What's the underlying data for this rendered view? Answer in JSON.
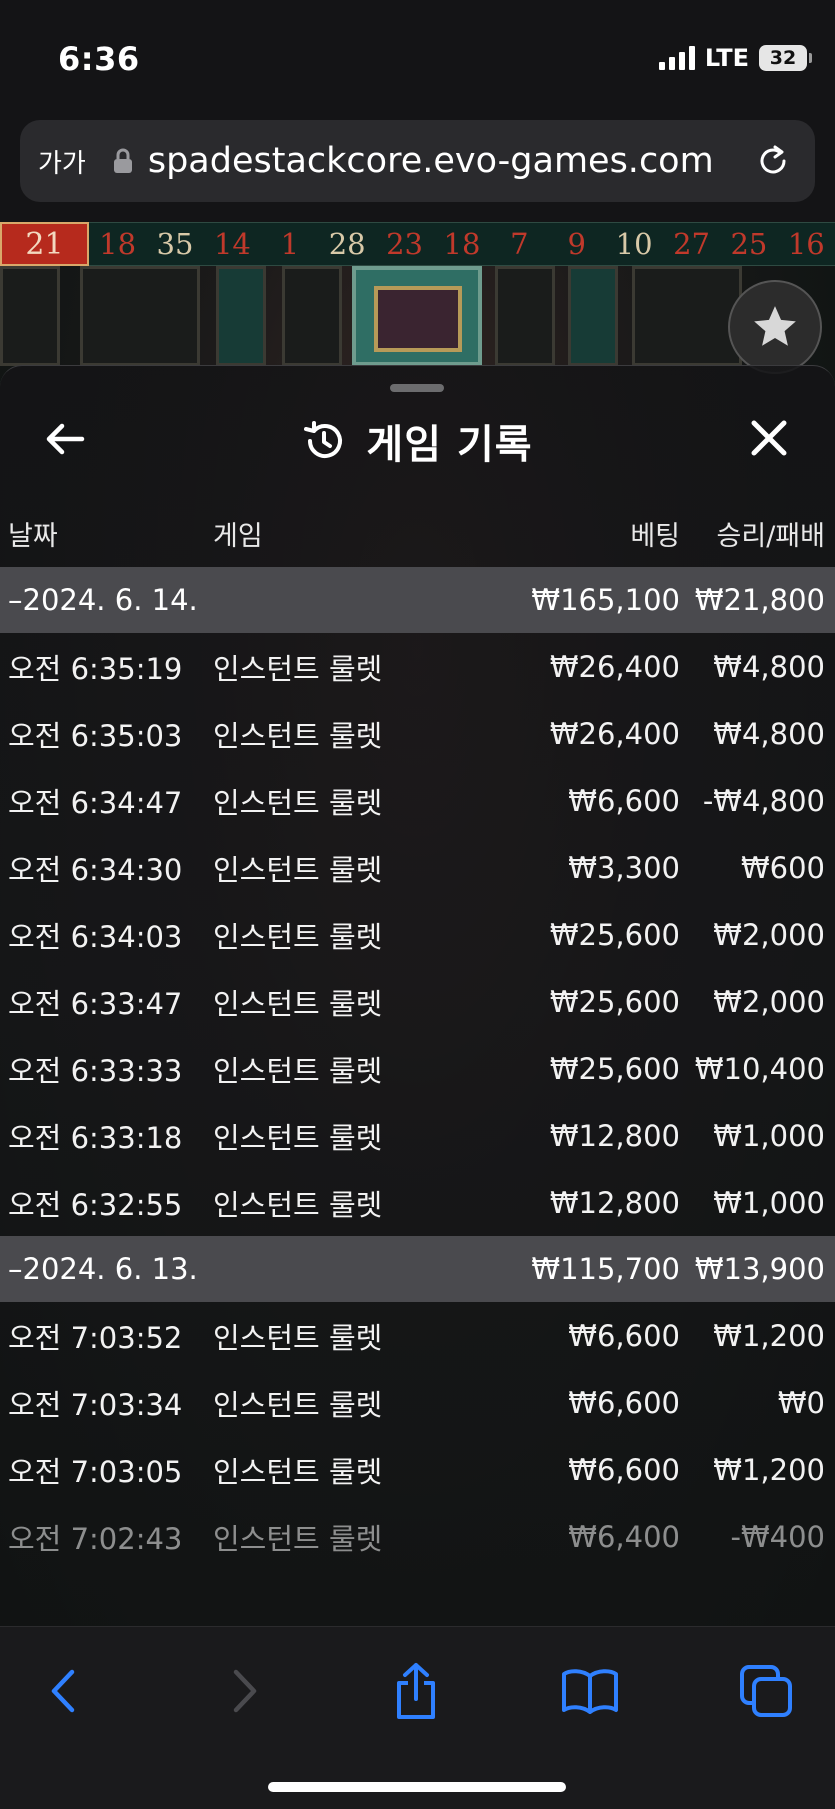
{
  "status_bar": {
    "time": "6:36",
    "network": "LTE",
    "battery": "32"
  },
  "browser": {
    "aa_label": "가가",
    "url": "spadestackcore.evo-games.com"
  },
  "results": {
    "current": "21",
    "numbers": [
      {
        "value": "18",
        "color": "#c0392b"
      },
      {
        "value": "35",
        "color": "#d8c9a8"
      },
      {
        "value": "14",
        "color": "#c0392b"
      },
      {
        "value": "1",
        "color": "#c0392b"
      },
      {
        "value": "28",
        "color": "#d8c9a8"
      },
      {
        "value": "23",
        "color": "#c0392b"
      },
      {
        "value": "18",
        "color": "#c0392b"
      },
      {
        "value": "7",
        "color": "#c0392b"
      },
      {
        "value": "9",
        "color": "#c0392b"
      },
      {
        "value": "10",
        "color": "#d8c9a8"
      },
      {
        "value": "27",
        "color": "#c0392b"
      },
      {
        "value": "25",
        "color": "#c0392b"
      },
      {
        "value": "16",
        "color": "#c0392b"
      }
    ]
  },
  "sheet": {
    "title": "게임 기록",
    "headers": {
      "date": "날짜",
      "game": "게임",
      "bet": "베팅",
      "win_loss": "승리/패배"
    }
  },
  "history": {
    "day1": {
      "date": "–2024. 6. 14.",
      "bet": "₩165,100",
      "win": "₩21,800",
      "rows": [
        {
          "time": "오전 6:35:19",
          "game": "인스턴트 룰렛",
          "bet": "₩26,400",
          "win": "₩4,800"
        },
        {
          "time": "오전 6:35:03",
          "game": "인스턴트 룰렛",
          "bet": "₩26,400",
          "win": "₩4,800"
        },
        {
          "time": "오전 6:34:47",
          "game": "인스턴트 룰렛",
          "bet": "₩6,600",
          "win": "-₩4,800"
        },
        {
          "time": "오전 6:34:30",
          "game": "인스턴트 룰렛",
          "bet": "₩3,300",
          "win": "₩600"
        },
        {
          "time": "오전 6:34:03",
          "game": "인스턴트 룰렛",
          "bet": "₩25,600",
          "win": "₩2,000"
        },
        {
          "time": "오전 6:33:47",
          "game": "인스턴트 룰렛",
          "bet": "₩25,600",
          "win": "₩2,000"
        },
        {
          "time": "오전 6:33:33",
          "game": "인스턴트 룰렛",
          "bet": "₩25,600",
          "win": "₩10,400"
        },
        {
          "time": "오전 6:33:18",
          "game": "인스턴트 룰렛",
          "bet": "₩12,800",
          "win": "₩1,000"
        },
        {
          "time": "오전 6:32:55",
          "game": "인스턴트 룰렛",
          "bet": "₩12,800",
          "win": "₩1,000"
        }
      ]
    },
    "day2": {
      "date": "–2024. 6. 13.",
      "bet": "₩115,700",
      "win": "₩13,900",
      "rows": [
        {
          "time": "오전 7:03:52",
          "game": "인스턴트 룰렛",
          "bet": "₩6,600",
          "win": "₩1,200"
        },
        {
          "time": "오전 7:03:34",
          "game": "인스턴트 룰렛",
          "bet": "₩6,600",
          "win": "₩0"
        },
        {
          "time": "오전 7:03:05",
          "game": "인스턴트 룰렛",
          "bet": "₩6,600",
          "win": "₩1,200"
        },
        {
          "time": "오전 7:02:43",
          "game": "인스턴트 룰렛",
          "bet": "₩6,400",
          "win": "-₩400"
        }
      ]
    }
  },
  "colors": {
    "accent_blue": "#2f80ff",
    "date_row_bg": "#4a4a4e",
    "current_result_bg": "#b62a1d"
  },
  "icons": {
    "lock": "lock-icon",
    "reload": "reload-icon",
    "back": "arrow-left-icon",
    "history": "history-icon",
    "close": "close-icon",
    "favorite": "star-icon",
    "nav_back": "chevron-left-icon",
    "nav_forward": "chevron-right-icon",
    "share": "share-icon",
    "bookmarks": "book-icon",
    "tabs": "tabs-icon"
  }
}
